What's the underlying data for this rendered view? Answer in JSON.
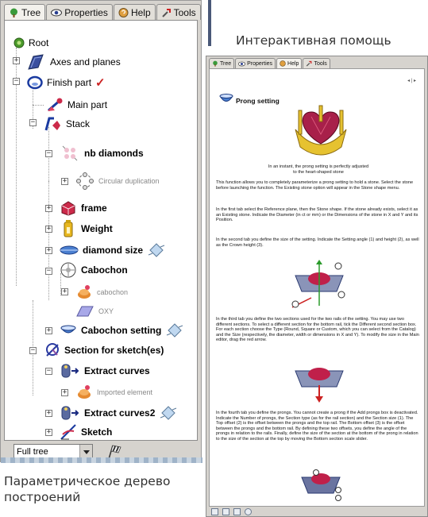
{
  "left_panel": {
    "tabs": [
      {
        "label": "Tree",
        "icon": "tree-icon",
        "active": true
      },
      {
        "label": "Properties",
        "icon": "eye-icon",
        "active": false
      },
      {
        "label": "Help",
        "icon": "help-icon",
        "active": false
      },
      {
        "label": "Tools",
        "icon": "tools-icon",
        "active": false
      }
    ],
    "tree": {
      "root": "Root",
      "axes_and_planes": "Axes and planes",
      "finish_part": "Finish part",
      "main_part": "Main part",
      "stack": "Stack",
      "nb_diamonds": "nb diamonds",
      "circular_duplication": "Circular duplication",
      "frame": "frame",
      "weight": "Weight",
      "diamond_size": "diamond size",
      "cabochon_group": "Cabochon",
      "cabochon_child": "cabochon",
      "oxy": "OXY",
      "cabochon_setting": "Cabochon setting",
      "section_for_sketch": "Section for sketch(es)",
      "extract_curves": "Extract curves",
      "imported_element": "Imported element",
      "extract_curves2": "Extract curves2",
      "sketch": "Sketch"
    },
    "filter": {
      "selected": "Full tree"
    }
  },
  "captions": {
    "top": "Интерактивная помощь",
    "bottom": "Параметрическое дерево построений"
  },
  "help_window": {
    "tabs": [
      {
        "label": "Tree",
        "icon": "tree-icon"
      },
      {
        "label": "Properties",
        "icon": "eye-icon"
      },
      {
        "label": "Help",
        "icon": "help-icon"
      },
      {
        "label": "Tools",
        "icon": "tools-icon"
      }
    ],
    "nav": "◂ | ▸",
    "title": "Prong setting",
    "caption_1": "In an instant, the prong setting is perfectly adjusted",
    "caption_2": "to the heart-shaped stone",
    "para_1": "This function allows you to completely parameterize a prong setting to hold a stone. Select the stone before launching the function. The Existing stone option will appear in the Stone shape menu.",
    "para_2": "In the first tab select the Reference plane, then the Stone shape. If the stone already exists, select it as an Existing stone. Indicate the Diameter (in ct or mm) or the Dimensions of the stone in X and Y and its Position.",
    "para_3": "In the second tab you define the size of the setting. Indicate the Setting angle (1) and height (2), as well as the Crown height (3).",
    "para_4": "In the third tab you define the two sections used for the two rails of the setting. You may use two different sections. To select a different section for the bottom rail, tick the Different second section box. For each section choose the Type (Round, Square or Custom, which you can select from the Catalog) and the Size (respectively, the diameter, width or dimensions in X and Y). To modify the size in the Main editor, drag the red arrow.",
    "para_5": "In the fourth tab you define the prongs. You cannot create a prong if the Add prongs box is deactivated. Indicate the Number of prongs, the Section type (as for the rail section) and the Section size (1). The Top offset (2) is the offset between the prongs and the top rail. The Bottom offset (3) is the offset between the prongs and the bottom rail. By defining these two offsets, you define the angle of the prongs in relation to the rails. Finally, define the size of the section at the bottom of the prong in relation to the size of the section at the top by moving the Bottom section scale slider."
  },
  "colors": {
    "panel_bg": "#d6d3ce",
    "caption_text": "#333333",
    "separator": "#4a5878",
    "accent_red": "#cc2222"
  }
}
